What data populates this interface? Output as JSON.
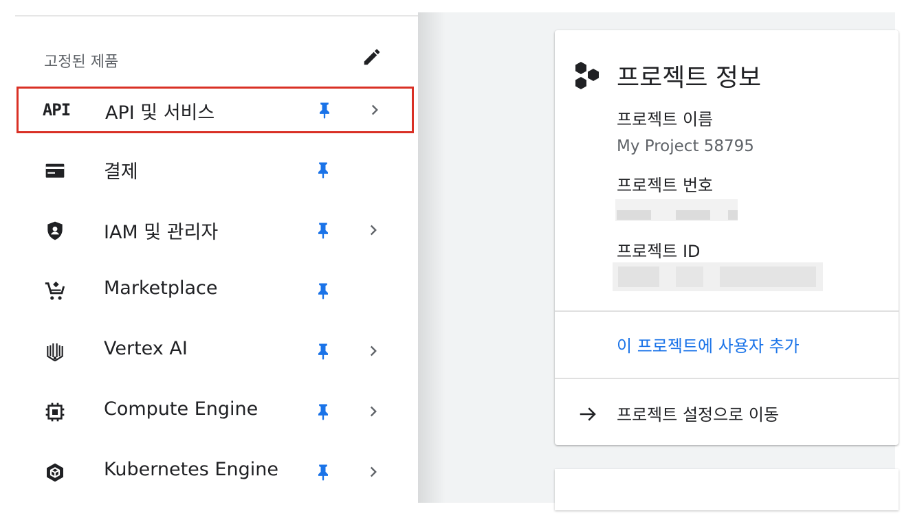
{
  "pinned": {
    "header": "고정된 제품",
    "items": [
      {
        "label": "API 및 서비스",
        "icon": "api-icon",
        "has_chevron": true,
        "selected": true
      },
      {
        "label": "결제",
        "icon": "billing-card-icon",
        "has_chevron": false
      },
      {
        "label": "IAM 및 관리자",
        "icon": "shield-icon",
        "has_chevron": true
      },
      {
        "label": "Marketplace",
        "icon": "marketplace-cart-icon",
        "has_chevron": false
      },
      {
        "label": "Vertex AI",
        "icon": "vertex-ai-icon",
        "has_chevron": true
      },
      {
        "label": "Compute Engine",
        "icon": "chip-icon",
        "has_chevron": true
      },
      {
        "label": "Kubernetes Engine",
        "icon": "kubernetes-icon",
        "has_chevron": true
      }
    ],
    "api_icon_text": "API"
  },
  "project_card": {
    "title": "프로젝트 정보",
    "name_label": "프로젝트 이름",
    "name_value": "My Project 58795",
    "number_label": "프로젝트 번호",
    "id_label": "프로젝트 ID",
    "add_user_link": "이 프로젝트에 사용자 추가",
    "settings_link": "프로젝트 설정으로 이동"
  },
  "colors": {
    "accent": "#1a73e8",
    "pin": "#1a73e8",
    "highlight_border": "#d93025"
  }
}
